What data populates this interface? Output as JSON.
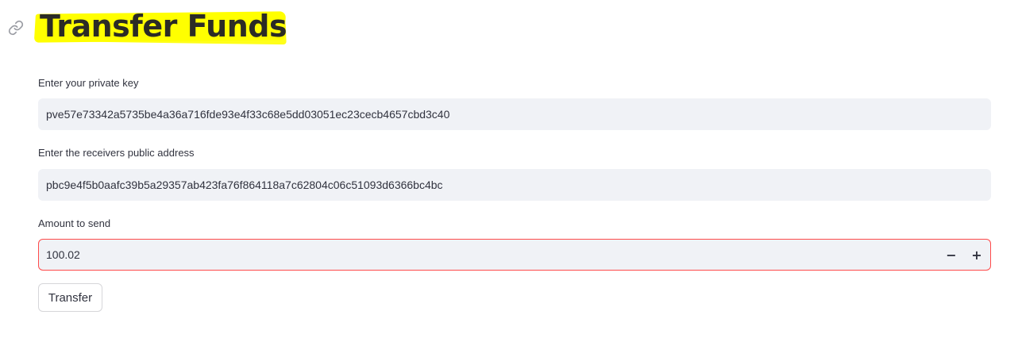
{
  "header": {
    "title": "Transfer Funds",
    "link_icon": "link-icon",
    "highlight_color": "#ffff00"
  },
  "form": {
    "private_key": {
      "label": "Enter your private key",
      "value": "pve57e73342a5735be4a36a716fde93e4f33c68e5dd03051ec23cecb4657cbd3c40"
    },
    "receiver_address": {
      "label": "Enter the receivers public address",
      "value": "pbc9e4f5b0aafc39b5a29357ab423fa76f864118a7c62804c06c51093d6366bc4bc"
    },
    "amount": {
      "label": "Amount to send",
      "value": "100.02",
      "decrement_label": "−",
      "increment_label": "+"
    },
    "submit_label": "Transfer"
  },
  "colors": {
    "input_background": "#f0f2f6",
    "focus_border": "#ff4b4b",
    "text": "#31333f"
  }
}
